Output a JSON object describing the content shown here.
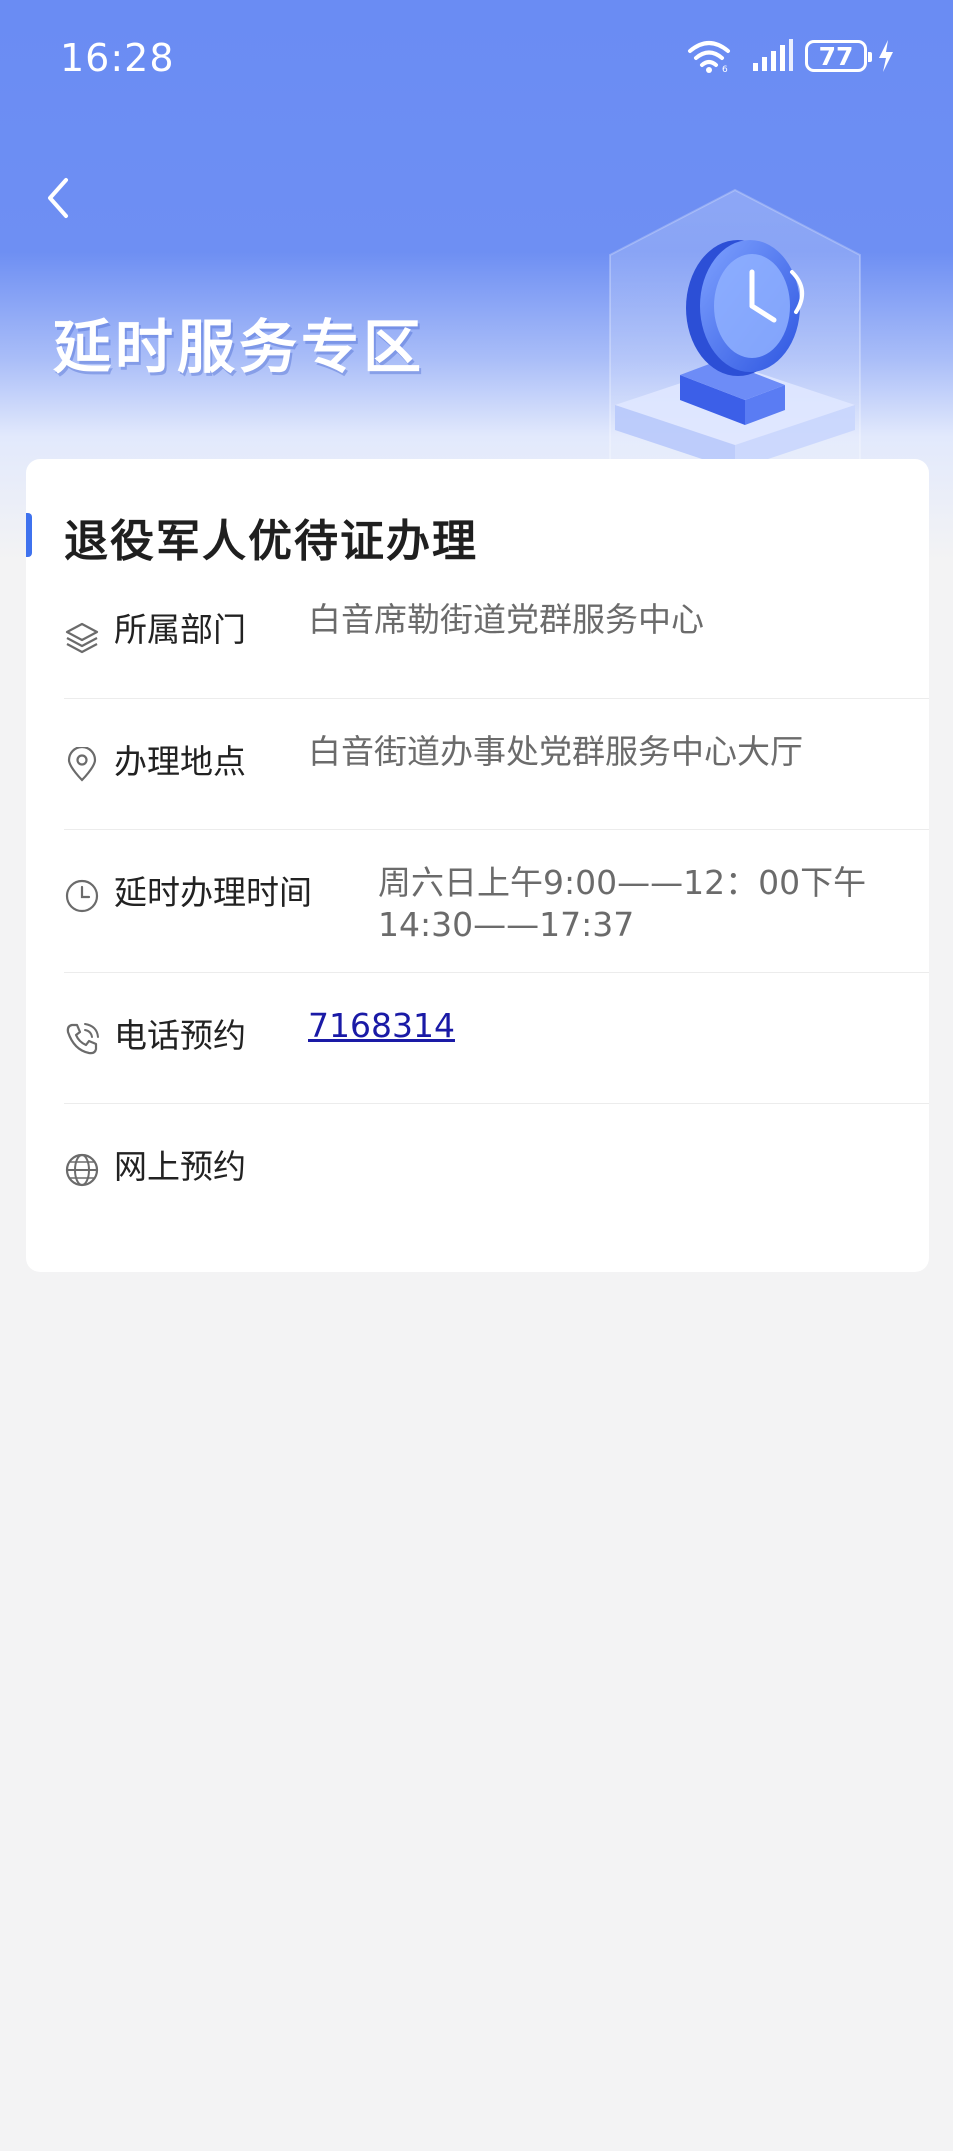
{
  "status_bar": {
    "time": "16:28",
    "battery": "77",
    "icons": [
      "wifi-icon",
      "signal-icon",
      "battery-icon",
      "charge-icon"
    ]
  },
  "header": {
    "back_icon": "chevron-left-icon",
    "title": "延时服务专区",
    "illustration": "clock-on-platform-illustration"
  },
  "card": {
    "title": "退役军人优待证办理",
    "rows": [
      {
        "icon": "layers-icon",
        "label": "所属部门",
        "value": "白音席勒街道党群服务中心"
      },
      {
        "icon": "location-pin-icon",
        "label": "办理地点",
        "value": "白音街道办事处党群服务中心大厅"
      },
      {
        "icon": "clock-icon",
        "label": "延时办理时间",
        "value_line1": "周六日上午9:00——12：00下午",
        "value_line2": "14:30——17:37"
      },
      {
        "icon": "phone-icon",
        "label": "电话预约",
        "value": "7168314"
      },
      {
        "icon": "globe-icon",
        "label": "网上预约",
        "value": ""
      }
    ]
  },
  "colors": {
    "header_blue": "#6a8cf3",
    "accent": "#3f72ee",
    "link": "#1a1aa6",
    "background": "#f3f3f4"
  }
}
